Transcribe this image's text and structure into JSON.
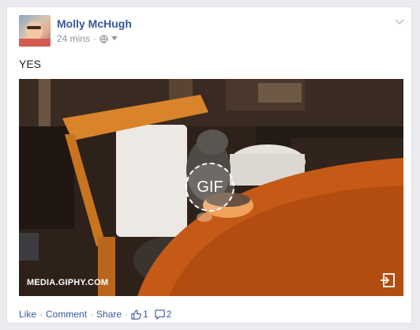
{
  "post": {
    "author": "Molly McHugh",
    "time": "24 mins",
    "meta_sep": "·",
    "text": "YES",
    "media": {
      "badge": "GIF",
      "source": "MEDIA.GIPHY.COM"
    }
  },
  "actions": {
    "like": "Like",
    "comment": "Comment",
    "share": "Share",
    "sep": "·",
    "like_count": "1",
    "comment_count": "2"
  },
  "icons": {
    "privacy": "globe-icon",
    "audience_menu": "caret-down-icon",
    "post_menu": "chevron-down-icon",
    "open_media": "open-external-icon",
    "likes": "thumbs-up-icon",
    "comments": "comment-bubble-icon"
  },
  "colors": {
    "link": "#365899",
    "muted": "#90949c",
    "text": "#1d2129"
  }
}
